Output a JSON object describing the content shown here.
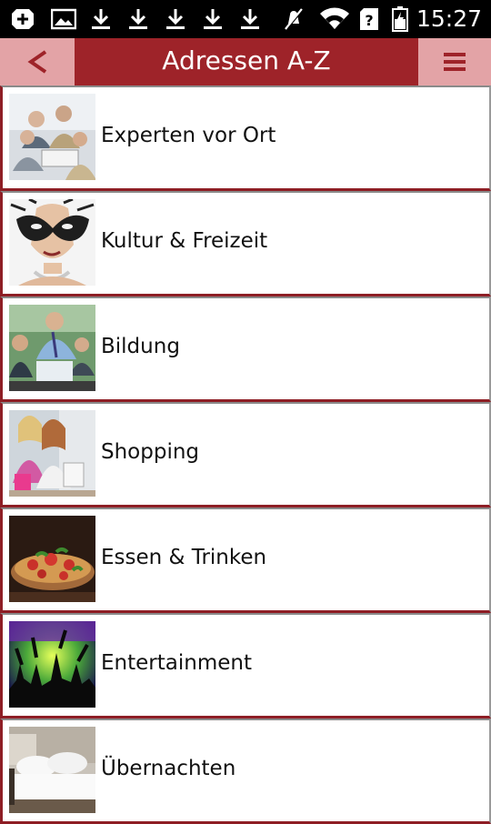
{
  "status_bar": {
    "time": "15:27",
    "icons": [
      "add-notification-icon",
      "image-icon",
      "download-icon",
      "download-icon",
      "download-icon",
      "download-icon",
      "download-icon",
      "mute-icon",
      "wifi-icon",
      "sim-unknown-icon",
      "battery-charging-icon"
    ]
  },
  "app_bar": {
    "title": "Adressen A-Z",
    "back_icon": "chevron-left-icon",
    "menu_icon": "hamburger-menu-icon"
  },
  "categories": [
    {
      "label": "Experten vor Ort",
      "thumb": "business-meeting-photo"
    },
    {
      "label": "Kultur & Freizeit",
      "thumb": "masquerade-mask-photo"
    },
    {
      "label": "Bildung",
      "thumb": "classroom-photo"
    },
    {
      "label": "Shopping",
      "thumb": "shopping-women-photo"
    },
    {
      "label": "Essen & Trinken",
      "thumb": "pizza-photo"
    },
    {
      "label": "Entertainment",
      "thumb": "concert-crowd-photo"
    },
    {
      "label": "Übernachten",
      "thumb": "hotel-bed-photo"
    }
  ],
  "colors": {
    "accent": "#9e2329",
    "accent_light": "#e3a3a6"
  }
}
